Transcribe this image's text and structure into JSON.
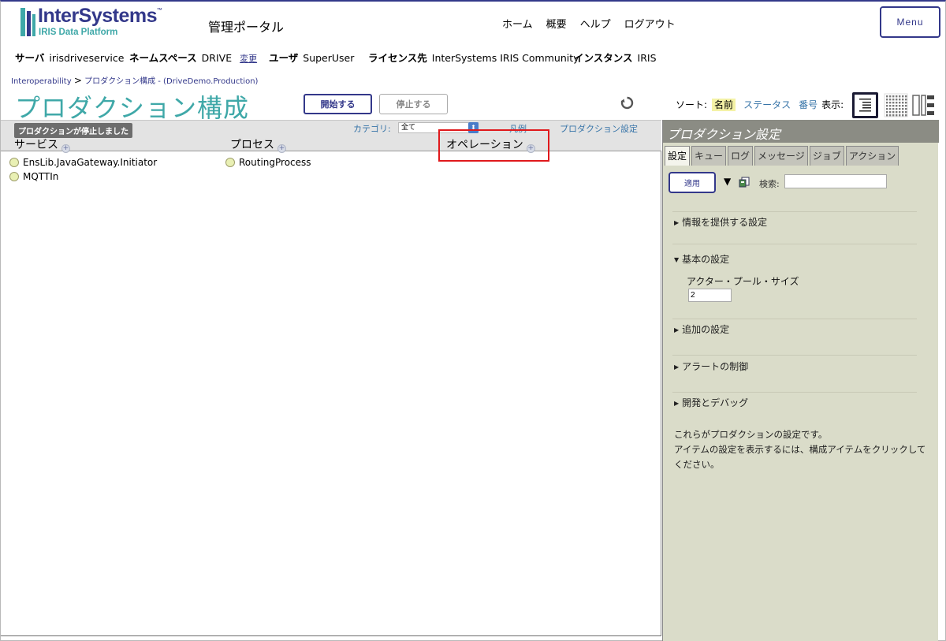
{
  "header": {
    "logo_text": "InterSystems",
    "logo_tm": "™",
    "logo_sub": "IRIS Data Platform",
    "portal_title": "管理ポータル",
    "nav": [
      "ホーム",
      "概要",
      "ヘルプ",
      "ログアウト"
    ],
    "menu_label": "Menu"
  },
  "info": {
    "server_label": "サーバ",
    "server_value": "irisdriveservice",
    "namespace_label": "ネームスペース",
    "namespace_value": "DRIVE",
    "change_link": "変更",
    "user_label": "ユーザ",
    "user_value": "SuperUser",
    "license_label": "ライセンス先",
    "license_value": "InterSystems IRIS Community",
    "instance_label": "インスタンス",
    "instance_value": "IRIS"
  },
  "breadcrumb": {
    "root": "Interoperability",
    "sep": ">",
    "current": "プロダクション構成",
    "production": "- (DriveDemo.Production)"
  },
  "page_title": "プロダクション構成",
  "toolbar": {
    "start_label": "開始する",
    "stop_label": "停止する",
    "sort_label": "ソート:",
    "sort_options": [
      "名前",
      "ステータス",
      "番号"
    ],
    "show_label": "表示:"
  },
  "production": {
    "status": "プロダクションが停止しました",
    "category_label": "カテゴリ:",
    "category_value": "全て",
    "legend_link": "凡例",
    "settings_link": "プロダクション設定",
    "columns": {
      "services": "サービス",
      "processes": "プロセス",
      "operations": "オペレーション"
    },
    "services": [
      "EnsLib.JavaGateway.Initiator",
      "MQTTIn"
    ],
    "processes": [
      "RoutingProcess"
    ],
    "operations": []
  },
  "settings_panel": {
    "title": "プロダクション設定",
    "tabs": [
      "設定",
      "キュー",
      "ログ",
      "メッセージ",
      "ジョブ",
      "アクション"
    ],
    "apply_label": "適用",
    "search_label": "検索:",
    "search_value": "",
    "sections": [
      "情報を提供する設定",
      "基本の設定",
      "追加の設定",
      "アラートの制御",
      "開発とデバッグ"
    ],
    "actor_pool_label": "アクター・プール・サイズ",
    "actor_pool_value": "2",
    "help_line1": "これらがプロダクションの設定です。",
    "help_line2": "アイテムの設定を表示するには、構成アイテムをクリックしてください。"
  },
  "colors": {
    "brand": "#33388a",
    "teal": "#3fa8a8",
    "link": "#3774a8",
    "highlight": "#e0191c",
    "panel_bg": "#dadcc9"
  }
}
